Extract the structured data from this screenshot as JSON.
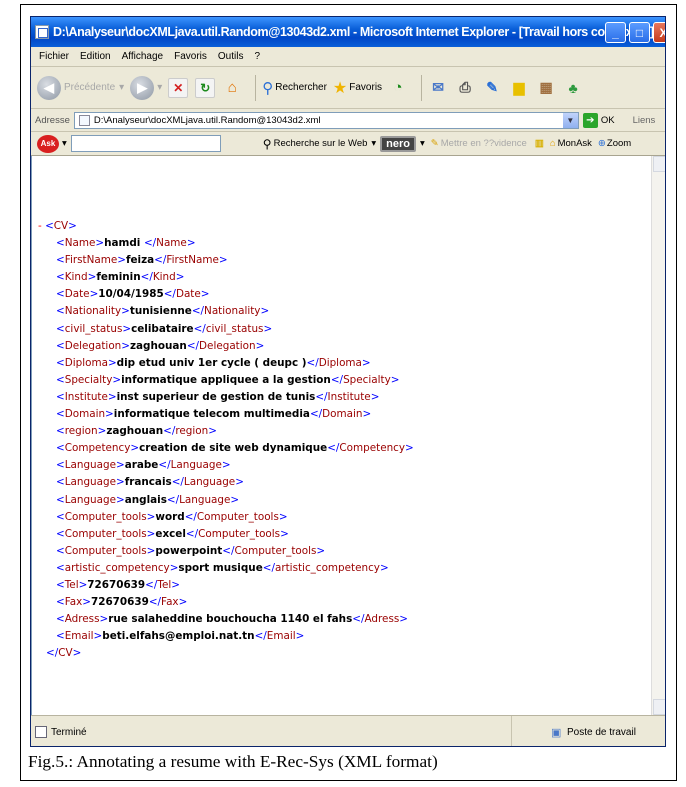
{
  "window": {
    "title": "D:\\Analyseur\\docXMLjava.util.Random@13043d2.xml - Microsoft Internet Explorer - [Travail hors connexion]"
  },
  "menu": [
    "Fichier",
    "Edition",
    "Affichage",
    "Favoris",
    "Outils",
    "?"
  ],
  "toolbar": {
    "back_label": "Précédente",
    "search_label": "Rechercher",
    "favorites_label": "Favoris"
  },
  "address": {
    "label": "Adresse",
    "value": "D:\\Analyseur\\docXMLjava.util.Random@13043d2.xml",
    "go_label": "OK",
    "links_label": "Liens"
  },
  "askbar": {
    "logo": "Ask",
    "web_search_label": "Recherche sur le Web",
    "nero_label": "nero",
    "highlight_label": "Mettre en ??vidence",
    "myask_label": "MonAsk",
    "zoom_label": "Zoom"
  },
  "xml": {
    "root_open": "CV",
    "root_close": "CV",
    "lines": [
      {
        "tag": "Name",
        "value": "hamdi "
      },
      {
        "tag": "FirstName",
        "value": "feiza"
      },
      {
        "tag": "Kind",
        "value": "feminin"
      },
      {
        "tag": "Date",
        "value": "10/04/1985"
      },
      {
        "tag": "Nationality",
        "value": "tunisienne"
      },
      {
        "tag": "civil_status",
        "value": "celibataire"
      },
      {
        "tag": "Delegation",
        "value": "zaghouan"
      },
      {
        "tag": "Diploma",
        "value": "dip etud univ 1er cycle ( deupc )"
      },
      {
        "tag": "Specialty",
        "value": "informatique appliquee a la gestion"
      },
      {
        "tag": "Institute",
        "value": "inst superieur de gestion de tunis"
      },
      {
        "tag": "Domain",
        "value": "informatique telecom multimedia"
      },
      {
        "tag": "region",
        "value": "zaghouan"
      },
      {
        "tag": "Competency",
        "value": "creation de site web dynamique"
      },
      {
        "tag": "Language",
        "value": "arabe"
      },
      {
        "tag": "Language",
        "value": "francais"
      },
      {
        "tag": "Language",
        "value": "anglais"
      },
      {
        "tag": "Computer_tools",
        "value": "word"
      },
      {
        "tag": "Computer_tools",
        "value": "excel"
      },
      {
        "tag": "Computer_tools",
        "value": "powerpoint"
      },
      {
        "tag": "artistic_competency",
        "value": "sport musique"
      },
      {
        "tag": "Tel",
        "value": "72670639"
      },
      {
        "tag": "Fax",
        "value": "72670639"
      },
      {
        "tag": "Adress",
        "value": "rue salaheddine bouchoucha 1140 el fahs"
      },
      {
        "tag": "Email",
        "value": "beti.elfahs@emploi.nat.tn"
      }
    ]
  },
  "status": {
    "left": "Terminé",
    "right": "Poste de travail"
  },
  "caption": "Fig.5.: Annotating a resume with E-Rec-Sys (XML format)"
}
